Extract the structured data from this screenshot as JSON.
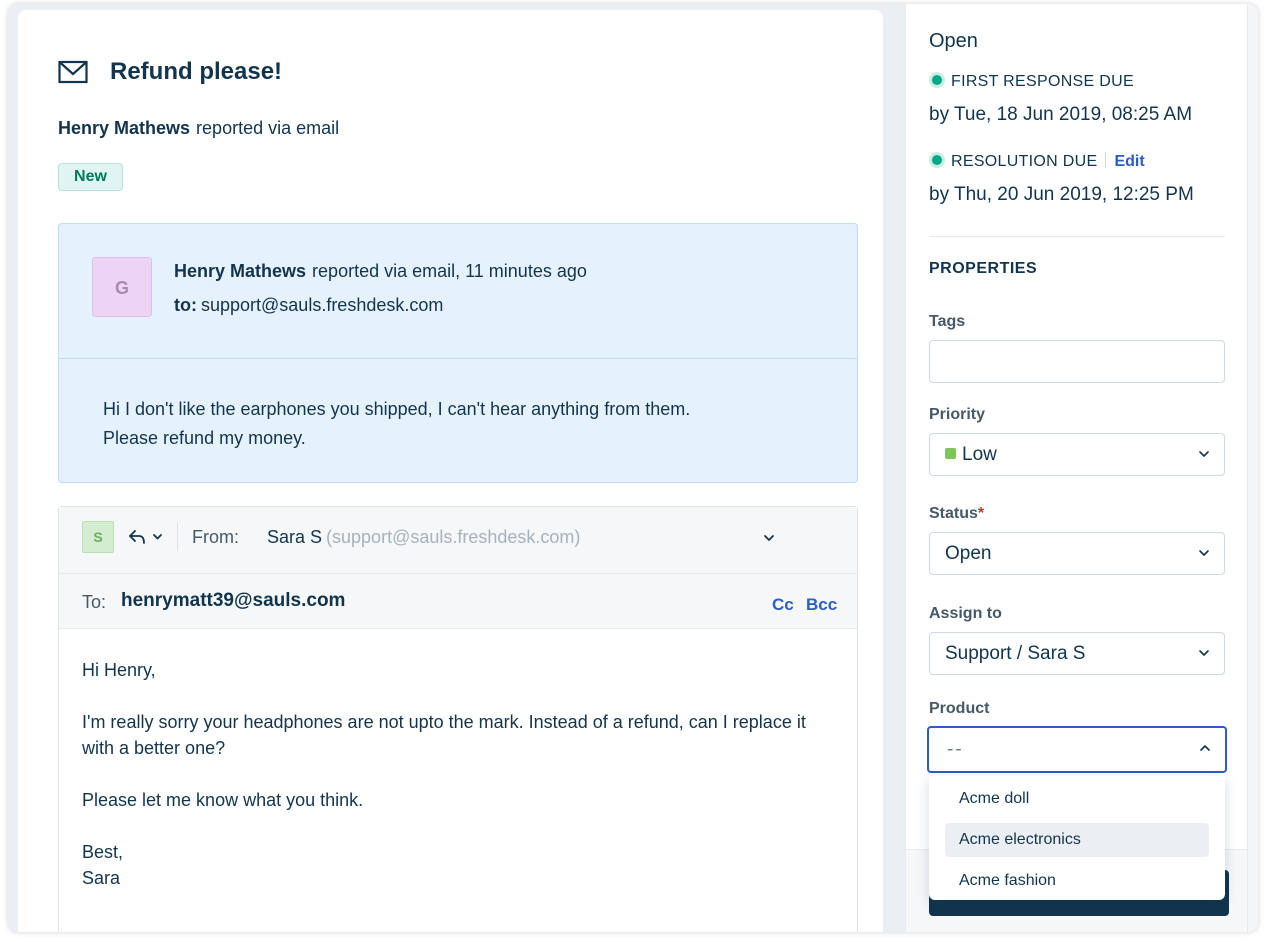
{
  "ticket": {
    "subject": "Refund please!",
    "reporter_name": "Henry Mathews",
    "reporter_via": "reported via email",
    "status_badge": "New"
  },
  "incoming_message": {
    "avatar_letter": "G",
    "sender_name": "Henry Mathews",
    "meta": "reported via email, 11 minutes ago",
    "to_label": "to:",
    "to_address": "support@sauls.freshdesk.com",
    "body_line1": "Hi I don't like the earphones you shipped, I can't hear anything from them.",
    "body_line2": "Please refund my money."
  },
  "reply": {
    "avatar_letter": "S",
    "from_label": "From:",
    "from_name": "Sara S",
    "from_email": "(support@sauls.freshdesk.com)",
    "to_label": "To:",
    "to_address": "henrymatt39@sauls.com",
    "cc_label": "Cc",
    "bcc_label": "Bcc",
    "body": {
      "greeting": "Hi Henry,",
      "paragraph1": "I'm really sorry your headphones are not upto the mark. Instead of a refund, can I replace it with a better one?",
      "paragraph2": "Please let me know what you think.",
      "signoff": "Best,",
      "signature": "Sara"
    }
  },
  "sidebar": {
    "status": "Open",
    "first_response_label": "FIRST RESPONSE DUE",
    "first_response_due": "by Tue, 18 Jun 2019, 08:25 AM",
    "resolution_label": "RESOLUTION DUE",
    "resolution_edit": "Edit",
    "resolution_due": "by Thu, 20 Jun 2019, 12:25 PM",
    "properties_title": "PROPERTIES",
    "tags_label": "Tags",
    "tags_value": "",
    "priority_label": "Priority",
    "priority_value": "Low",
    "status_label": "Status",
    "status_required": "*",
    "status_value": "Open",
    "assign_label": "Assign to",
    "assign_value": "Support / Sara S",
    "product_label": "Product",
    "product_value": "--",
    "product_options": [
      "Acme doll",
      "Acme electronics",
      "Acme fashion"
    ]
  },
  "colors": {
    "accent": "#2c5cc5",
    "text": "#12344d",
    "sla_green": "#00a886",
    "priority_low": "#7fc65a",
    "badge_new": "#00795b"
  }
}
